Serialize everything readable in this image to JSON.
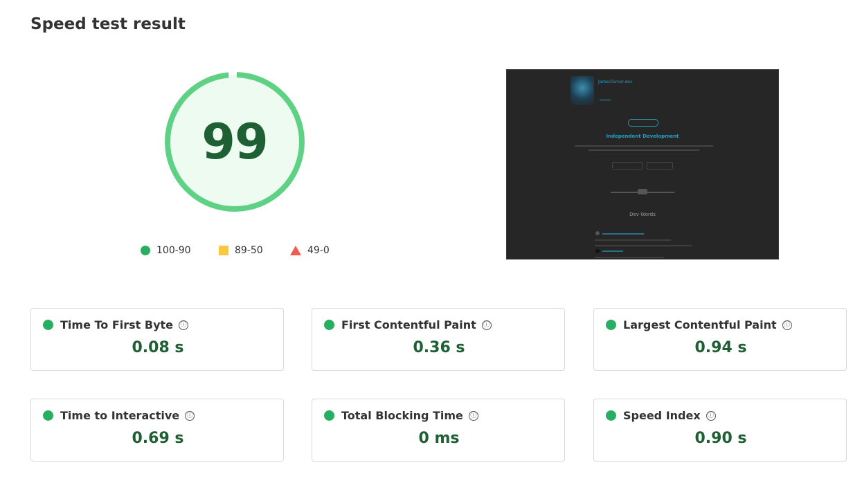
{
  "page": {
    "title": "Speed test result"
  },
  "score": {
    "value": "99",
    "fraction": 0.99,
    "color": "#5fd185",
    "fill": "#edfbf1",
    "text_color": "#1e5f33"
  },
  "legend": {
    "good": {
      "label": "100-90",
      "color": "#27ae60",
      "icon": "green-circle-icon"
    },
    "average": {
      "label": "89-50",
      "color": "#f8c840",
      "icon": "yellow-square-icon"
    },
    "poor": {
      "label": "49-0",
      "color": "#f05a4f",
      "icon": "red-triangle-icon"
    }
  },
  "screenshot": {
    "brand": "JamesTurner.dev",
    "heading": "Independent Development",
    "section": "Dev Words"
  },
  "metrics": [
    {
      "label": "Time To First Byte",
      "value": "0.08 s",
      "status": "good"
    },
    {
      "label": "First Contentful Paint",
      "value": "0.36 s",
      "status": "good"
    },
    {
      "label": "Largest Contentful Paint",
      "value": "0.94 s",
      "status": "good"
    },
    {
      "label": "Time to Interactive",
      "value": "0.69 s",
      "status": "good"
    },
    {
      "label": "Total Blocking Time",
      "value": "0 ms",
      "status": "good"
    },
    {
      "label": "Speed Index",
      "value": "0.90 s",
      "status": "good"
    }
  ],
  "info_icon": "ⓘ"
}
